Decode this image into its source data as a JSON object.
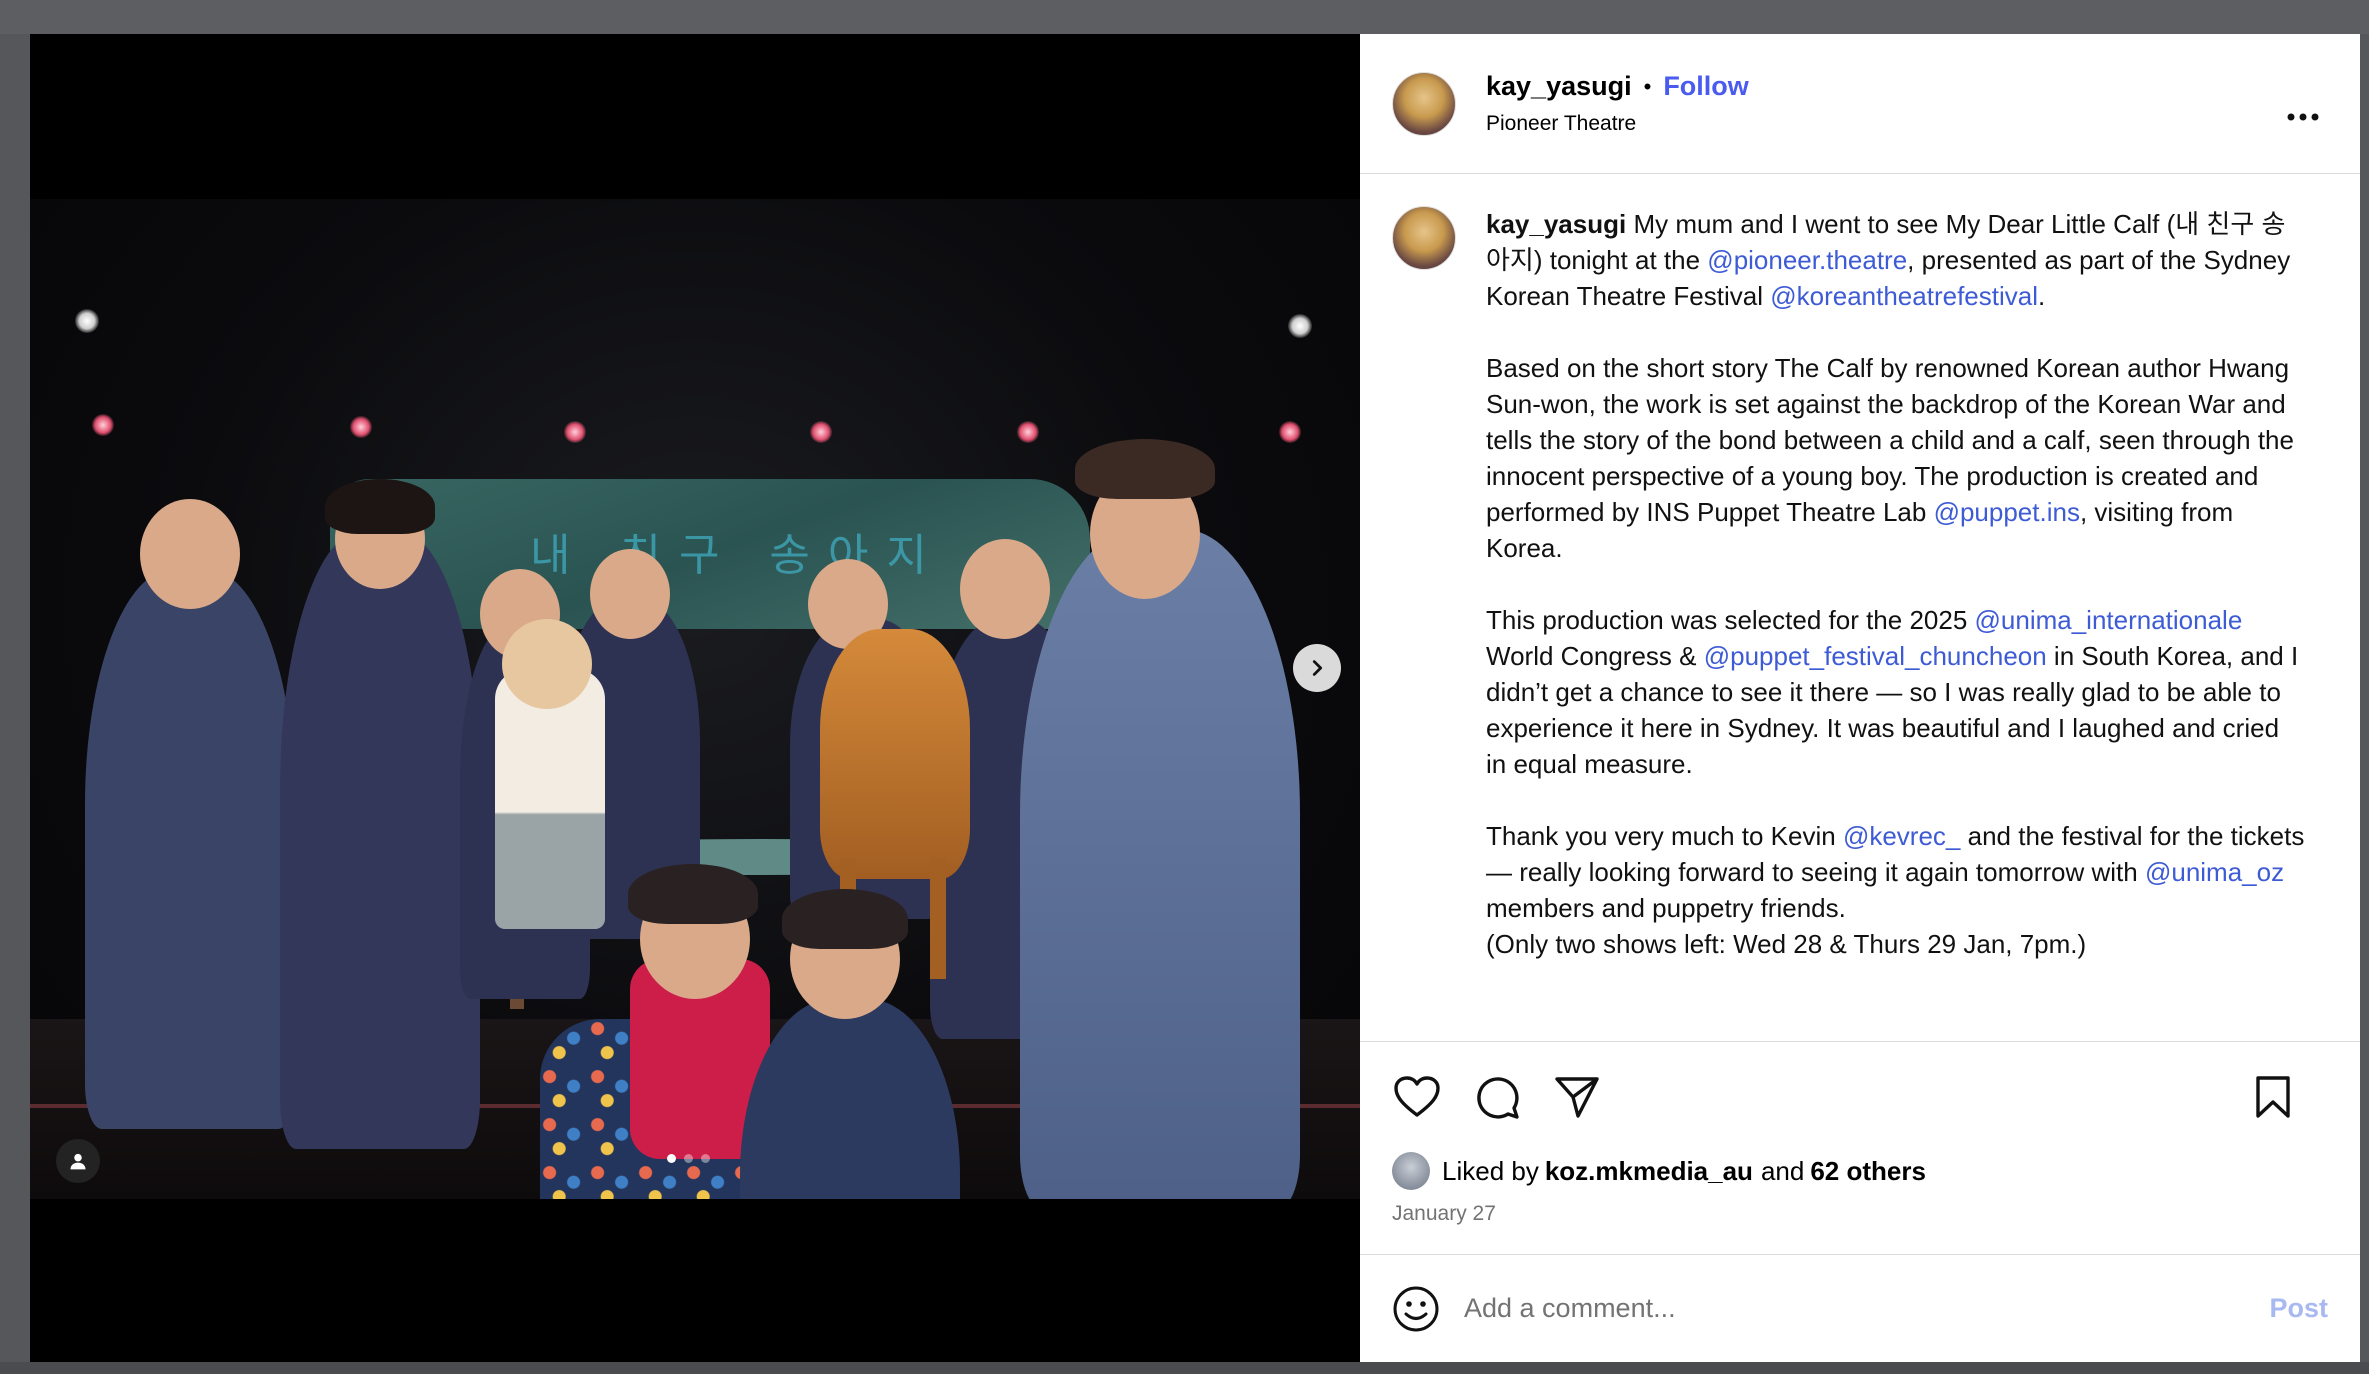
{
  "post": {
    "username": "kay_yasugi",
    "follow_label": "Follow",
    "bullet": "•",
    "location": "Pioneer Theatre",
    "more_label": "•••"
  },
  "media": {
    "sign_text": "내 친구 송아지",
    "slide_count": 3,
    "active_slide": 1,
    "next_icon": "chevron-right-icon",
    "user_tag_icon": "user-icon"
  },
  "caption": {
    "username": "kay_yasugi",
    "p1_a": " My mum and I went to see My Dear Little Calf (내 친구 송아지) tonight at the ",
    "m_pioneer": "@pioneer.theatre",
    "p1_b": ", presented as part of the Sydney Korean Theatre Festival ",
    "m_ktf": "@koreantheatrefestival",
    "p1_c": ".",
    "p2_a": "Based on the short story The Calf by renowned Korean author Hwang Sun-won, the work is set against the backdrop of the Korean War and tells the story of the bond between a child and a calf, seen through the innocent perspective of a young boy. The production is created and performed by INS Puppet Theatre Lab ",
    "m_puppet": "@puppet.ins",
    "p2_b": ", visiting from Korea.",
    "p3_a": "This production was selected for the 2025 ",
    "m_unima": "@unima_internationale",
    "p3_b": " World Congress & ",
    "m_chuncheon": "@puppet_festival_chuncheon",
    "p3_c": " in South Korea, and I didn’t get a chance to see it there — so I was really glad to be able to experience it here in Sydney. It was beautiful and I laughed and cried in equal measure.",
    "p4_a": "Thank you very much to Kevin ",
    "m_kevrec": "@kevrec_",
    "p4_b": " and the festival for the tickets — really looking forward to seeing it again tomorrow with ",
    "m_unimaoz": "@unima_oz",
    "p4_c": " members and puppetry friends.",
    "p4_d": "(Only two shows left: Wed 28 & Thurs 29 Jan, 7pm.)"
  },
  "actions": {
    "like_icon": "heart-icon",
    "comment_icon": "comment-icon",
    "share_icon": "share-icon",
    "save_icon": "bookmark-icon"
  },
  "likes": {
    "prefix": "Liked by ",
    "liker": "koz.mkmedia_au",
    "middle": " and ",
    "others": "62 others"
  },
  "date": "January 27",
  "comment_box": {
    "placeholder": "Add a comment...",
    "post_label": "Post",
    "emoji_icon": "emoji-icon"
  },
  "colors": {
    "mention": "#3e5bd6",
    "follow": "#4a5cf0",
    "post_disabled": "#a7b9f0"
  }
}
